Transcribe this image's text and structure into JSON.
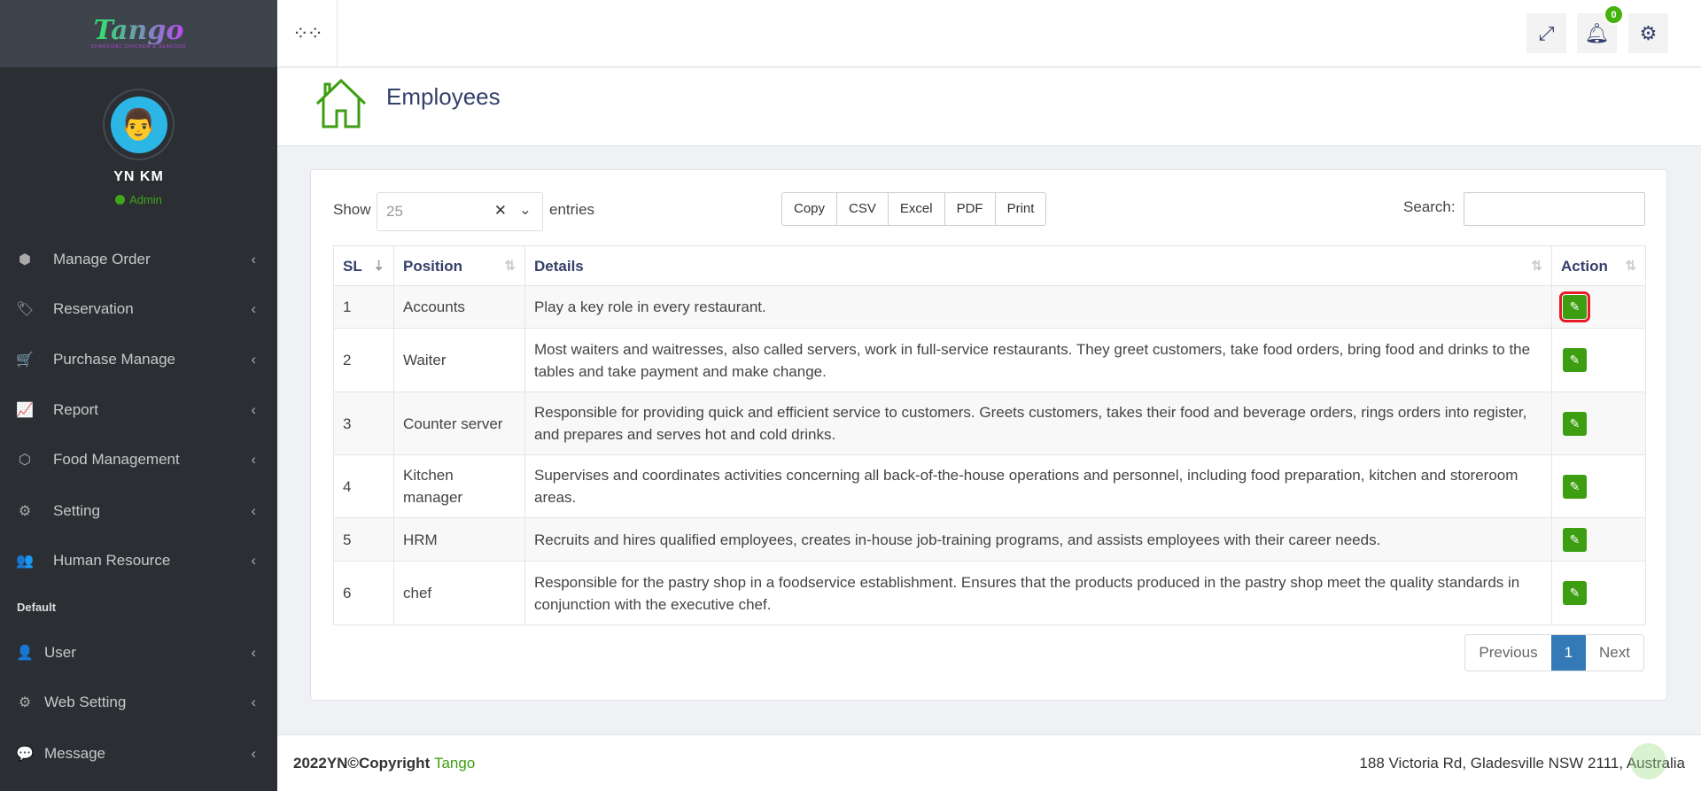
{
  "brand": {
    "name": "Tango",
    "tagline": "CHARCOAL CHICKEN & SEAFOOD"
  },
  "user": {
    "name": "YN KM",
    "role": "Admin"
  },
  "sidebar": {
    "items": [
      {
        "label": "Manage Order",
        "icon": "hexagon-icon"
      },
      {
        "label": "Reservation",
        "icon": "tags-icon"
      },
      {
        "label": "Purchase Manage",
        "icon": "cart-icon"
      },
      {
        "label": "Report",
        "icon": "chart-line-icon"
      },
      {
        "label": "Food Management",
        "icon": "cube-icon"
      },
      {
        "label": "Setting",
        "icon": "gear-icon"
      },
      {
        "label": "Human Resource",
        "icon": "users-icon"
      }
    ],
    "section": "Default",
    "items2": [
      {
        "label": "User",
        "icon": "user-icon"
      },
      {
        "label": "Web Setting",
        "icon": "gear-icon"
      },
      {
        "label": "Message",
        "icon": "message-icon"
      }
    ]
  },
  "topbar": {
    "notifications": "0"
  },
  "page": {
    "title": "Employees"
  },
  "table_controls": {
    "show": "Show",
    "entries_value": "25",
    "entries": "entries",
    "buttons": [
      "Copy",
      "CSV",
      "Excel",
      "PDF",
      "Print"
    ],
    "search_label": "Search:",
    "search_value": ""
  },
  "table": {
    "headers": [
      "SL",
      "Position",
      "Details",
      "Action"
    ],
    "rows": [
      {
        "sl": "1",
        "position": "Accounts",
        "details": "Play a key role in every restaurant."
      },
      {
        "sl": "2",
        "position": "Waiter",
        "details": "Most waiters and waitresses, also called servers, work in full-service restaurants. They greet customers, take food orders, bring food and drinks to the tables and take payment and make change."
      },
      {
        "sl": "3",
        "position": "Counter server",
        "details": "Responsible for providing quick and efficient service to customers. Greets customers, takes their food and beverage orders, rings orders into register, and prepares and serves hot and cold drinks."
      },
      {
        "sl": "4",
        "position": "Kitchen manager",
        "details": "Supervises and coordinates activities concerning all back-of-the-house operations and personnel, including food preparation, kitchen and storeroom areas."
      },
      {
        "sl": "5",
        "position": "HRM",
        "details": "Recruits and hires qualified employees, creates in-house job-training programs, and assists employees with their career needs."
      },
      {
        "sl": "6",
        "position": "chef",
        "details": "Responsible for the pastry shop in a foodservice establishment. Ensures that the products produced in the pastry shop meet the quality standards in conjunction with the executive chef."
      }
    ]
  },
  "pagination": {
    "previous": "Previous",
    "current": "1",
    "next": "Next"
  },
  "footer": {
    "copyright": "2022YN©Copyright",
    "brand": "Tango",
    "address": "188 Victoria Rd, Gladesville NSW 2111, Australia"
  }
}
